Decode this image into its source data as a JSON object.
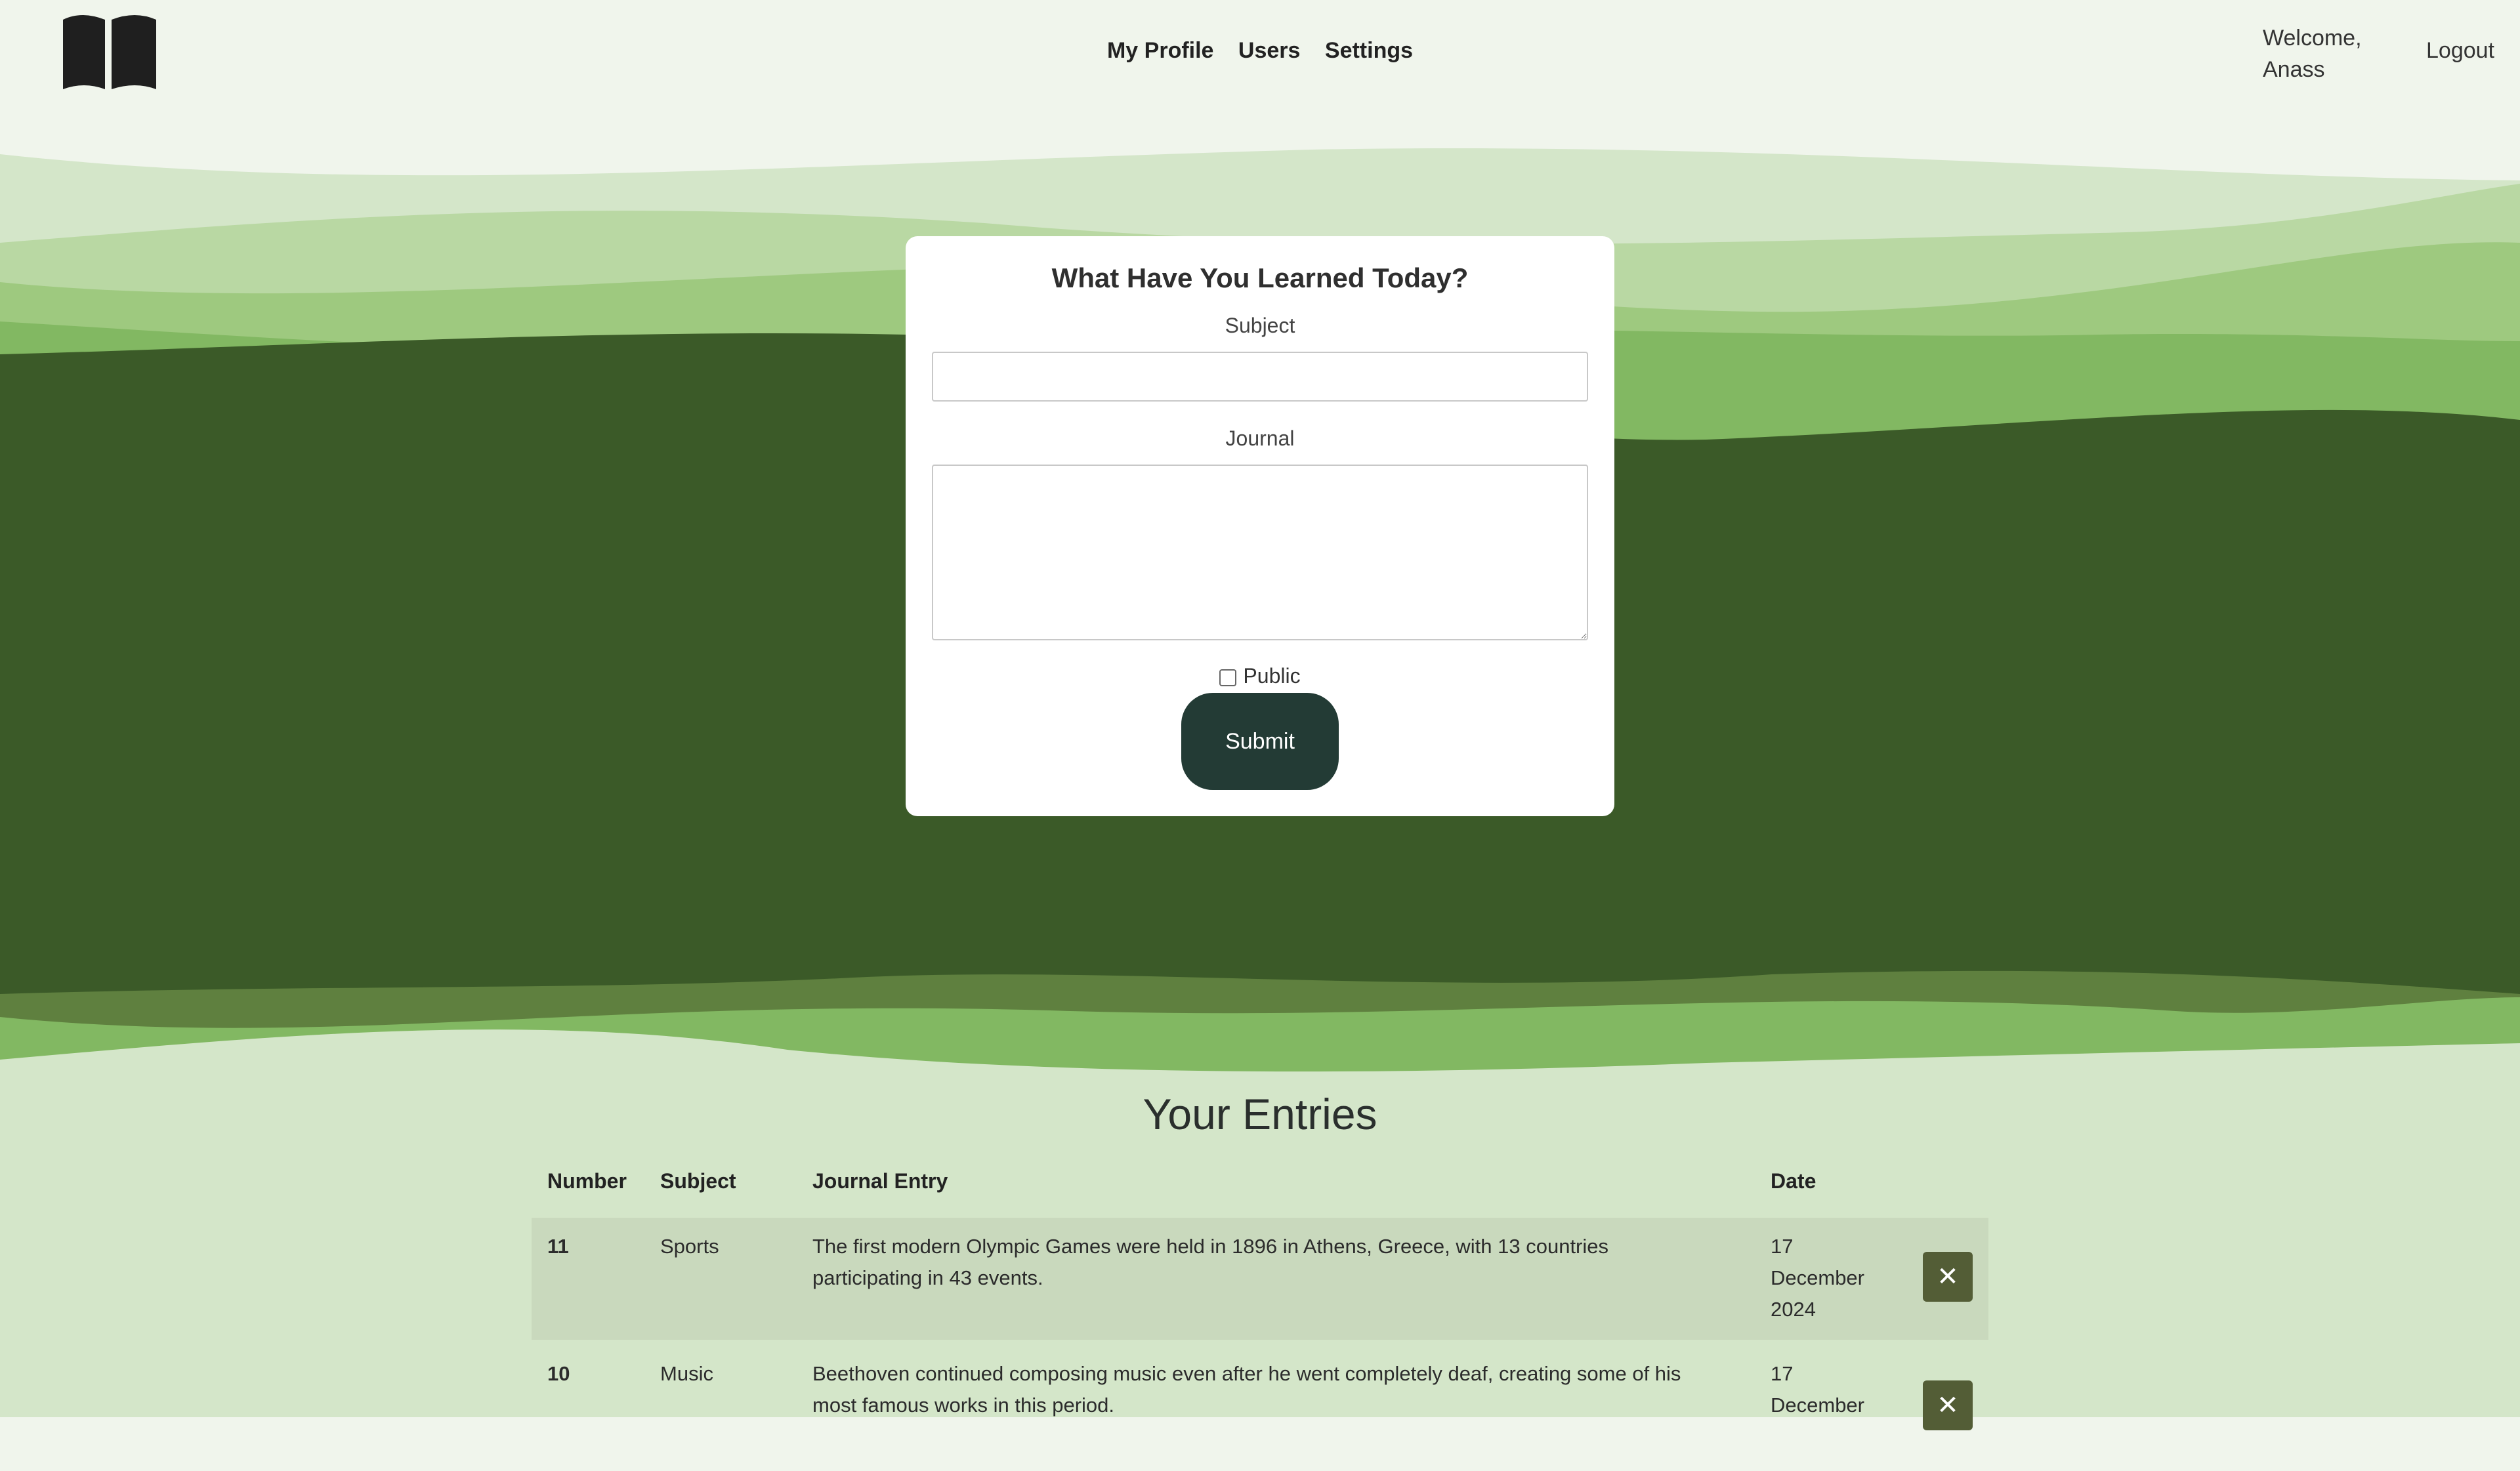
{
  "header": {
    "nav": [
      "My Profile",
      "Users",
      "Settings"
    ],
    "welcome_line1": "Welcome,",
    "welcome_line2": "Anass",
    "logout": "Logout"
  },
  "form": {
    "title": "What Have You Learned Today?",
    "subject_label": "Subject",
    "subject_value": "",
    "journal_label": "Journal",
    "journal_value": "",
    "public_label": "Public",
    "public_checked": false,
    "submit_label": "Submit"
  },
  "entries": {
    "title": "Your Entries",
    "columns": [
      "Number",
      "Subject",
      "Journal Entry",
      "Date"
    ],
    "rows": [
      {
        "number": "11",
        "subject": "Sports",
        "entry_line1": "The first modern Olympic Games were held in 1896 in Athens, Greece, with 13 countries",
        "entry_line2": "participating in 43 events.",
        "date_line1": "17",
        "date_line2": "December",
        "date_line3": "2024",
        "delete": "✕"
      },
      {
        "number": "10",
        "subject": "Music",
        "entry_line1": "Beethoven continued composing music even after he went completely deaf, creating some of his",
        "entry_line2": "most famous works in this period.",
        "date_line1": "17",
        "date_line2": "December",
        "delete": "✕"
      }
    ]
  },
  "colors": {
    "background": "#f0f5ec",
    "dark_green": "#3b5a28",
    "button": "#233b35",
    "delete_button": "#535d36",
    "row_highlight": "#c9d9bd"
  }
}
